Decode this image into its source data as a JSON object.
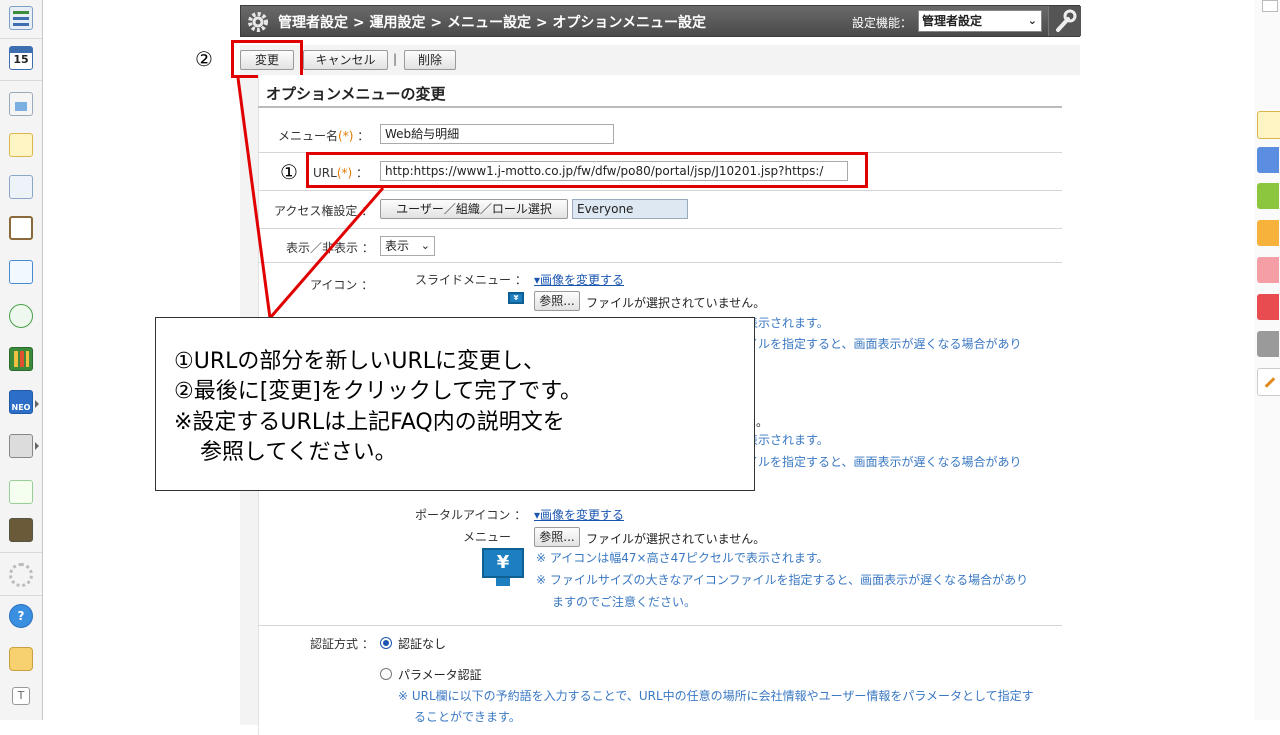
{
  "titlebar": {
    "breadcrumb": "管理者設定 > 運用設定 > メニュー設定 > オプションメニュー設定",
    "settings_label": "設定機能：",
    "settings_value": "管理者設定"
  },
  "toolbar": {
    "change_label": "変更",
    "cancel_label": "キャンセル",
    "separator": "|",
    "delete_label": "削除"
  },
  "markers": {
    "one": "①",
    "two": "②"
  },
  "form": {
    "title": "オプションメニューの変更",
    "menu_name_label": "メニュー名",
    "req_mark": "(*)",
    "colon": "：",
    "menu_name_value": "Web給与明細",
    "url_label": "URL",
    "url_value": "http:https://www1.j-motto.co.jp/fw/dfw/po80/portal/jsp/J10201.jsp?https:/",
    "access_label": "アクセス権設定",
    "access_button": "ユーザー／組織／ロール選択",
    "access_value": "Everyone",
    "display_label": "表示／非表示",
    "display_value": "表示",
    "icon_label": "アイコン",
    "slide_menu_label": "スライドメニュー",
    "change_image_link": "▾画像を変更する",
    "browse_button": "参照...",
    "no_file": "ファイルが選択されていません。",
    "note_size_partial": "表示されます。",
    "note_slow_partial": "イルを指定すると、画面表示が遅くなる場合があり",
    "partial_char": "。",
    "portal_icon_label": "ポータルアイコン",
    "portal_menu_label": "メニュー",
    "portal_note_size": "※ アイコンは幅47×高さ47ピクセルで表示されます。",
    "portal_note_slow": "※ ファイルサイズの大きなアイコンファイルを指定すると、画面表示が遅くなる場合があり",
    "portal_note_slow2": "ますのでご注意ください。",
    "auth_label": "認証方式",
    "auth_none": "認証なし",
    "auth_param": "パラメータ認証",
    "auth_note1": "※ URL欄に以下の予約語を入力することで、URL中の任意の場所に会社情報やユーザー情報をパラメータとして指定す",
    "auth_note2": "ることができます。"
  },
  "callout": {
    "line1": "①URLの部分を新しいURLに変更し、",
    "line2": "②最後に[変更]をクリックして完了です。",
    "line3": "※設定するURLは上記FAQ内の説明文を",
    "line4": "参照してください。"
  },
  "sidebar": {
    "calendar_day": "15",
    "neo_label": "NEO"
  },
  "colors": {
    "annotation_red": "#e00000",
    "note_blue": "#3a78c2",
    "required_orange": "#e07b00"
  }
}
